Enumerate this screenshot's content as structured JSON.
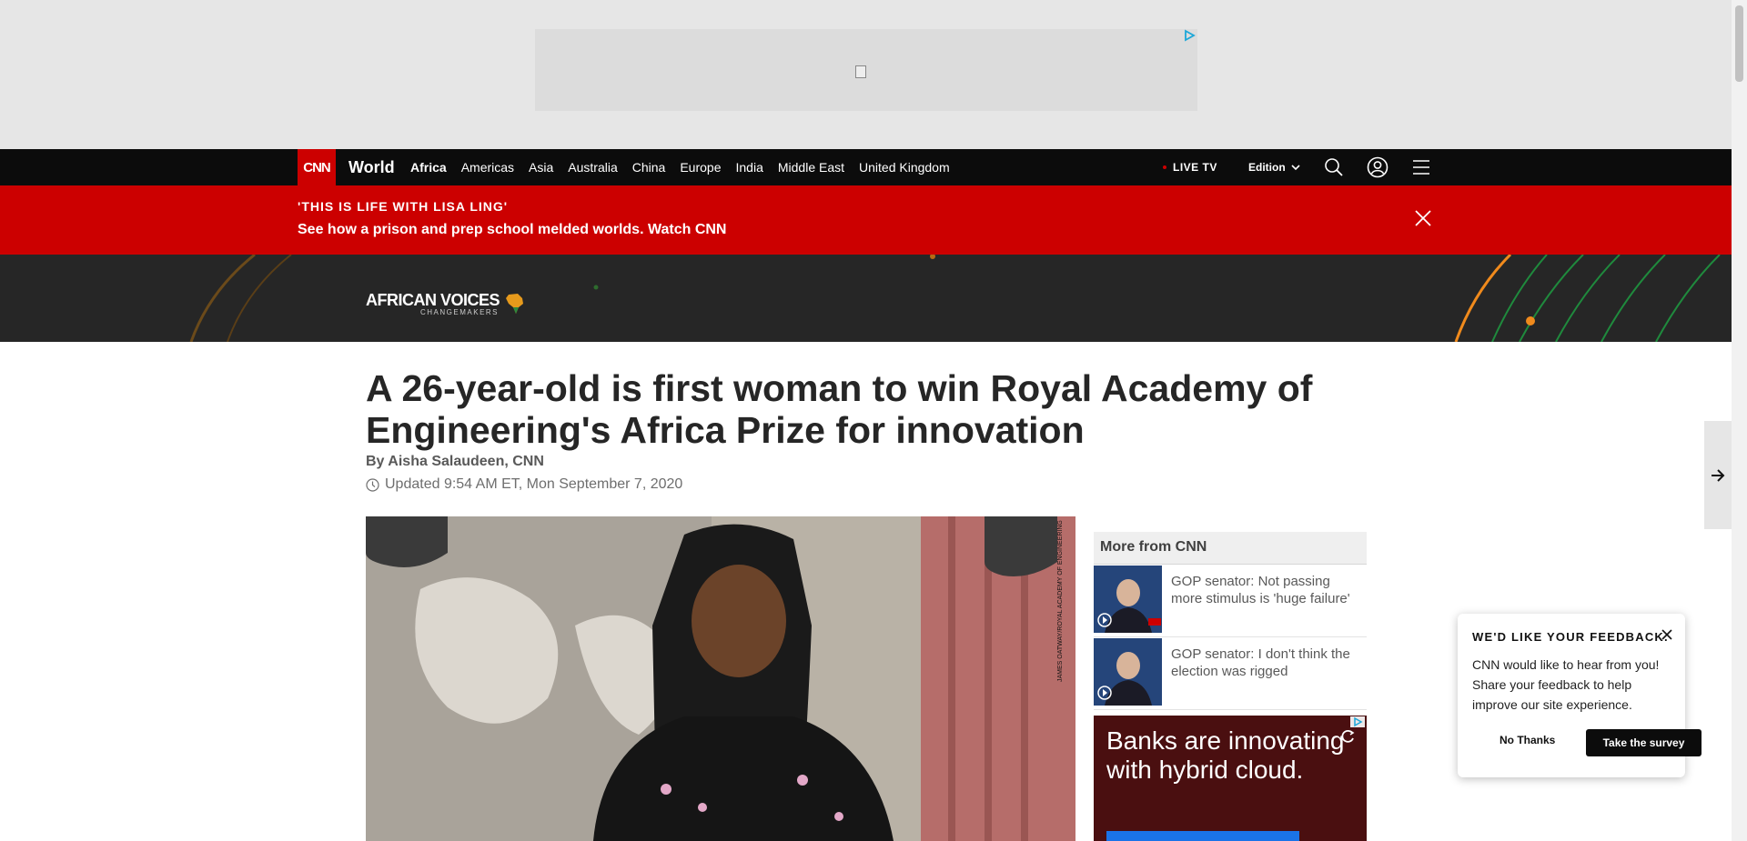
{
  "nav": {
    "logo": "CNN",
    "section_title": "World",
    "links": [
      "Africa",
      "Americas",
      "Asia",
      "Australia",
      "China",
      "Europe",
      "India",
      "Middle East",
      "United Kingdom"
    ],
    "active_link": "Africa",
    "live_tv": "LIVE TV",
    "edition": "Edition"
  },
  "banner": {
    "kicker": "'THIS IS LIFE WITH LISA LING'",
    "headline": "See how a prison and prep school melded worlds. Watch CNN"
  },
  "section_brand": {
    "name": "AFRICAN VOICES",
    "sub": "CHANGEMAKERS"
  },
  "article": {
    "title": "A 26-year-old is first woman to win Royal Academy of Engineering's Africa Prize for innovation",
    "byline": "By Aisha Salaudeen, CNN",
    "updated": "Updated 9:54 AM ET, Mon September 7, 2020",
    "photo_credit": "JAMES OATWAY/ROYAL ACADEMY OF ENGINEERING"
  },
  "sidebar": {
    "heading": "More from CNN",
    "items": [
      {
        "text": "GOP senator: Not passing more stimulus is 'huge failure'"
      },
      {
        "text": "GOP senator: I don't think the election was rigged"
      }
    ],
    "ad_text": "Banks are innovating with hybrid cloud."
  },
  "feedback": {
    "heading": "WE'D LIKE YOUR FEEDBACK.",
    "body": "CNN would like to hear from you! Share your feedback to help improve our site experience.",
    "no_label": "No Thanks",
    "yes_label": "Take the survey"
  },
  "colors": {
    "brand_red": "#cc0000",
    "nav_bg": "#0c0c0c",
    "section_bg": "#262626"
  }
}
